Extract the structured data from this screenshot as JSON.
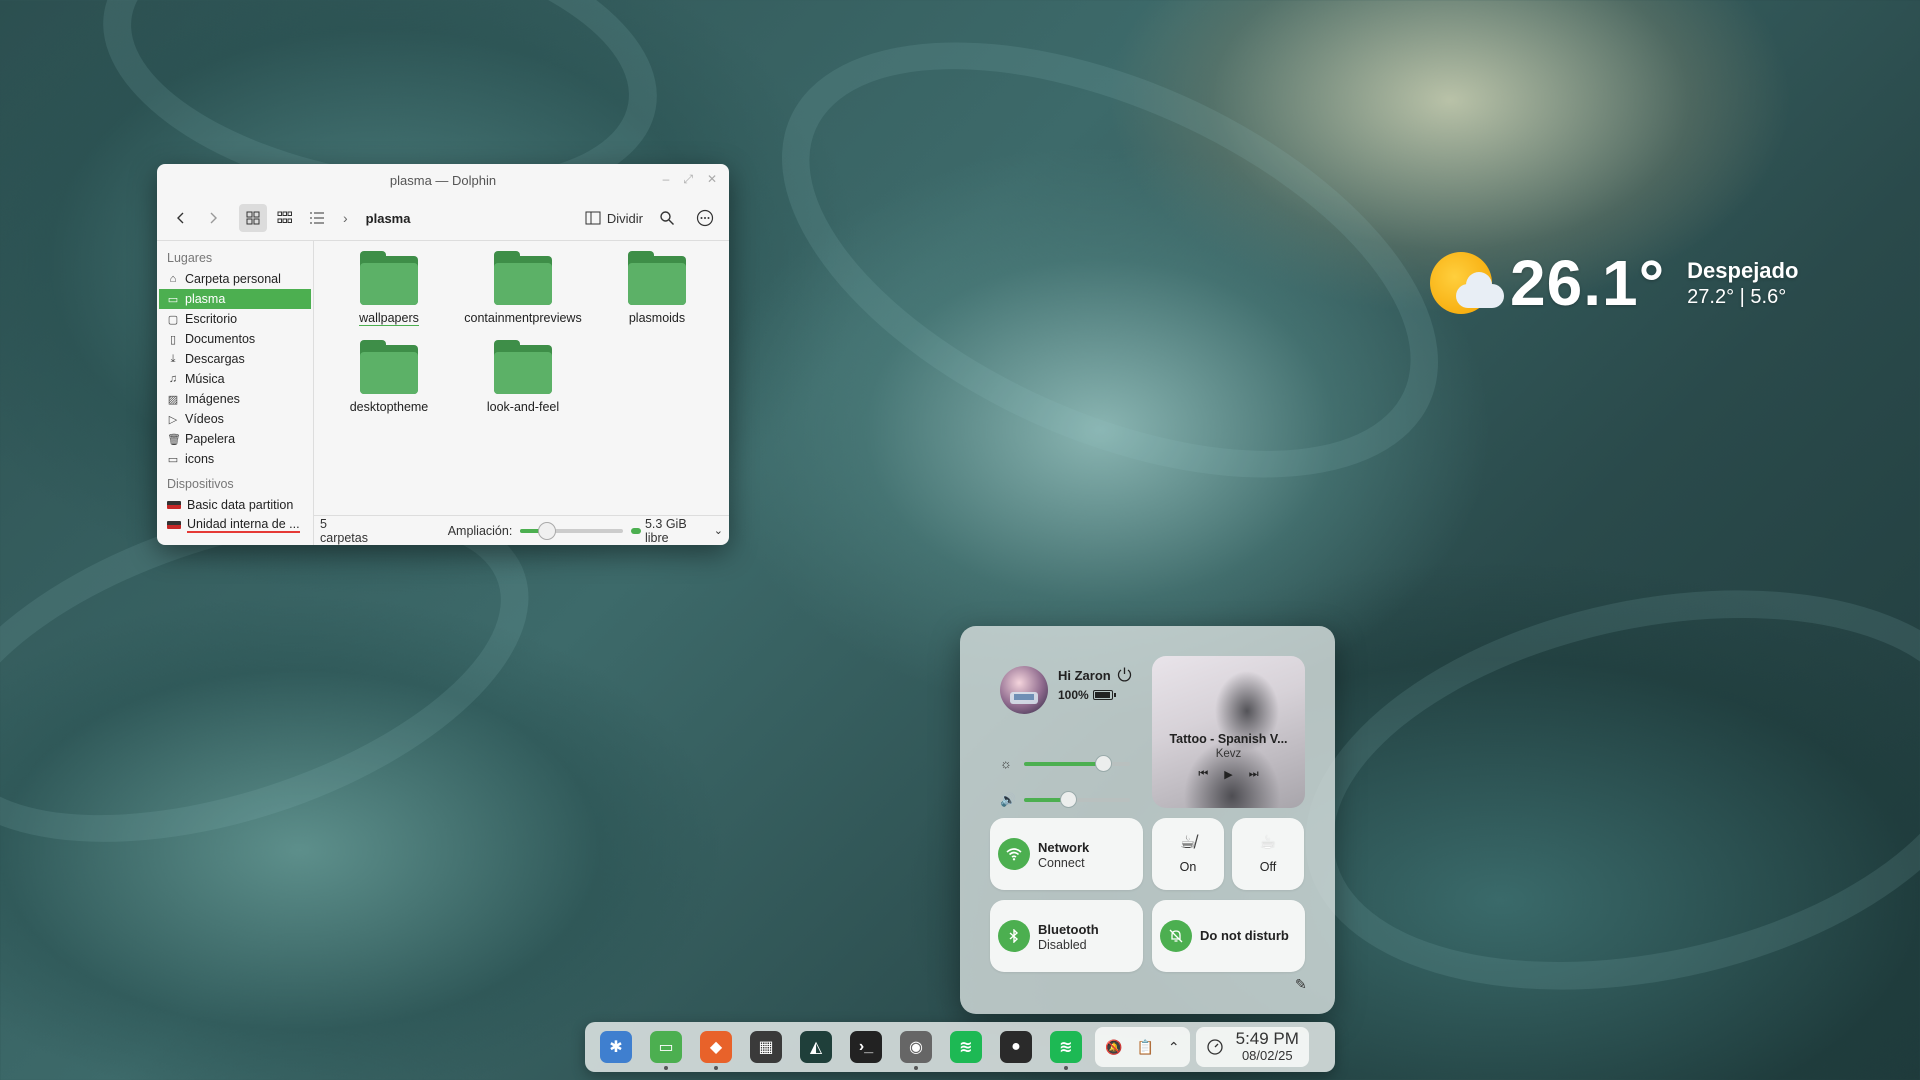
{
  "dolphin": {
    "title": "plasma — Dolphin",
    "breadcrumb": "plasma",
    "split_label": "Dividir",
    "places_header": "Lugares",
    "places": [
      {
        "label": "Carpeta personal",
        "icon": "home-icon"
      },
      {
        "label": "plasma",
        "icon": "folder-icon",
        "active": true
      },
      {
        "label": "Escritorio",
        "icon": "desktop-icon"
      },
      {
        "label": "Documentos",
        "icon": "document-icon"
      },
      {
        "label": "Descargas",
        "icon": "download-icon"
      },
      {
        "label": "Música",
        "icon": "music-icon"
      },
      {
        "label": "Imágenes",
        "icon": "image-icon"
      },
      {
        "label": "Vídeos",
        "icon": "video-icon"
      },
      {
        "label": "Papelera",
        "icon": "trash-icon"
      },
      {
        "label": "icons",
        "icon": "folder-icon"
      }
    ],
    "devices_header": "Dispositivos",
    "devices": [
      {
        "label": "Basic data partition"
      },
      {
        "label": "Unidad interna de ..."
      }
    ],
    "folders": [
      "wallpapers",
      "containmentpreviews",
      "plasmoids",
      "desktoptheme",
      "look-and-feel"
    ],
    "status_count": "5 carpetas",
    "zoom_label": "Ampliación:",
    "zoom_level": 0.25,
    "free_space": "5.3 GiB libre",
    "accent": "#4caf50"
  },
  "weather": {
    "temperature": "26.1°",
    "condition": "Despejado",
    "range": "27.2° | 5.6°",
    "icon": "partly-cloudy-icon"
  },
  "control_center": {
    "greeting": "Hi Zaron",
    "battery": "100%",
    "battery_level": 1.0,
    "brightness_level": 0.75,
    "volume_level": 0.42,
    "media": {
      "title": "Tattoo - Spanish V...",
      "artist": "Kevz"
    },
    "network": {
      "title": "Network",
      "subtitle": "Connect"
    },
    "toggle_one": {
      "label": "On",
      "icon": "caffeine-off-icon"
    },
    "toggle_two": {
      "label": "Off",
      "icon": "coffee-cup-icon"
    },
    "bluetooth": {
      "title": "Bluetooth",
      "subtitle": "Disabled"
    },
    "dnd": {
      "title": "Do not disturb"
    }
  },
  "taskbar": {
    "apps": [
      {
        "name": "settings",
        "color": "#3f7fcf",
        "glyph": "✱"
      },
      {
        "name": "files",
        "color": "#4caf50",
        "glyph": "▭"
      },
      {
        "name": "gitlab",
        "color": "#e8622a",
        "glyph": "◆"
      },
      {
        "name": "store",
        "color": "#3a3a3a",
        "glyph": "▦"
      },
      {
        "name": "image-viewer",
        "color": "#1f3f3a",
        "glyph": "◭"
      },
      {
        "name": "terminal",
        "color": "#222222",
        "glyph": "›_"
      },
      {
        "name": "chrome",
        "color": "#666666",
        "glyph": "◉"
      },
      {
        "name": "spotify",
        "color": "#1db954",
        "glyph": "≋"
      },
      {
        "name": "github",
        "color": "#2a2a2a",
        "glyph": "●"
      },
      {
        "name": "spotify-2",
        "color": "#1db954",
        "glyph": "≋"
      }
    ],
    "time": "5:49 PM",
    "date": "08/02/25"
  }
}
